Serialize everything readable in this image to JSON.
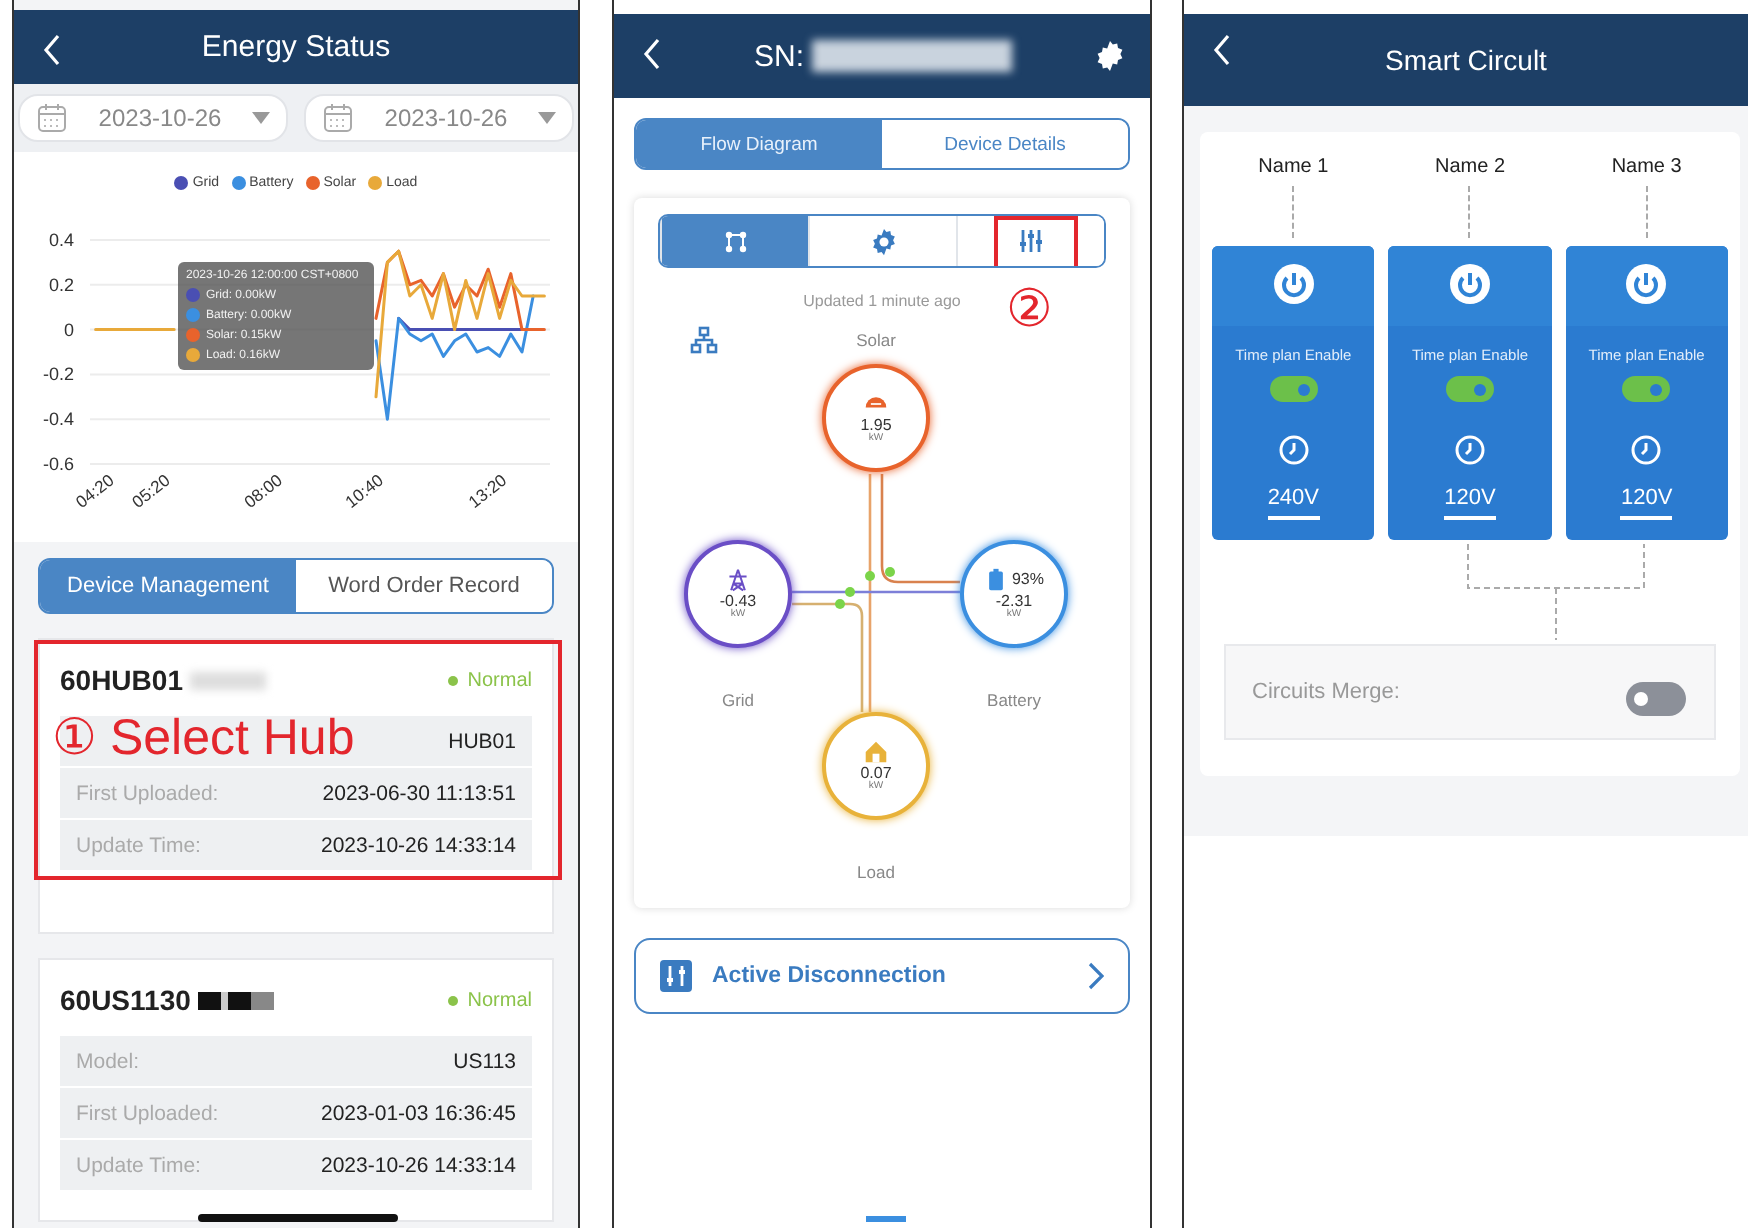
{
  "energy_status": {
    "title": "Energy Status",
    "date_from": "2023-10-26",
    "date_to": "2023-10-26",
    "chart_data": {
      "type": "line",
      "categories": [
        "04:20",
        null,
        null,
        null,
        null,
        "05:20",
        null,
        null,
        null,
        null,
        null,
        null,
        null,
        null,
        null,
        "08:00",
        null,
        null,
        null,
        null,
        null,
        null,
        null,
        null,
        "10:40",
        null,
        null,
        null,
        null,
        null,
        null,
        null,
        null,
        null,
        null,
        "13:20",
        null,
        null,
        null,
        null,
        null
      ],
      "grid": true,
      "legend": true,
      "ylim": [
        -0.6,
        0.4
      ],
      "yticks": [
        0.4,
        0.2,
        0,
        -0.2,
        -0.4,
        -0.6
      ],
      "series": [
        {
          "name": "Grid",
          "color": "#4a4fb3",
          "values": [
            null,
            null,
            null,
            null,
            null,
            null,
            null,
            null,
            null,
            null,
            null,
            null,
            null,
            null,
            null,
            null,
            null,
            null,
            null,
            null,
            null,
            null,
            null,
            null,
            null,
            null,
            null,
            0.05,
            0,
            0,
            0,
            0,
            0,
            0,
            0,
            0,
            0,
            0,
            0,
            null,
            null
          ]
        },
        {
          "name": "Battery",
          "color": "#3b8fe0",
          "values": [
            null,
            null,
            null,
            null,
            null,
            null,
            null,
            null,
            null,
            null,
            null,
            null,
            null,
            null,
            null,
            null,
            null,
            null,
            null,
            null,
            null,
            null,
            null,
            null,
            null,
            -0.05,
            -0.4,
            0.05,
            -0.02,
            -0.05,
            -0.02,
            -0.12,
            -0.05,
            -0.02,
            -0.1,
            -0.08,
            -0.12,
            -0.02,
            -0.1,
            0.15,
            null
          ]
        },
        {
          "name": "Solar",
          "color": "#e8632c",
          "values": [
            null,
            null,
            null,
            null,
            null,
            null,
            null,
            null,
            null,
            null,
            null,
            null,
            null,
            null,
            null,
            null,
            null,
            null,
            null,
            null,
            null,
            null,
            null,
            null,
            null,
            0.05,
            0.3,
            0.35,
            0.2,
            0.22,
            0.15,
            0.25,
            0.1,
            0.2,
            0.15,
            0.27,
            0.1,
            0.25,
            0,
            0,
            0
          ]
        },
        {
          "name": "Load",
          "color": "#e8a93a",
          "values": [
            0,
            0,
            0,
            0,
            0,
            0,
            0,
            0,
            null,
            null,
            null,
            null,
            null,
            null,
            null,
            null,
            null,
            null,
            null,
            null,
            null,
            null,
            null,
            null,
            null,
            -0.3,
            0.3,
            0.35,
            0.15,
            0.2,
            0.05,
            0.25,
            0,
            0.22,
            0.05,
            0.25,
            0.05,
            0.22,
            0.15,
            0.15,
            0.15
          ]
        }
      ]
    },
    "tooltip": {
      "title": "2023-10-26 12:00:00 CST+0800",
      "items": [
        "Grid: 0.00kW",
        "Battery: 0.00kW",
        "Solar: 0.15kW",
        "Load: 0.16kW"
      ]
    },
    "tabs": [
      {
        "label": "Device Management",
        "selected": true
      },
      {
        "label": "Word Order Record",
        "selected": false
      }
    ],
    "devices": [
      {
        "serial": "60HUB01",
        "status": "Normal",
        "rows": [
          {
            "value": "HUB01"
          },
          {
            "label": "First Uploaded:",
            "value": "2023-06-30 11:13:51"
          },
          {
            "label": "Update Time:",
            "value": "2023-10-26 14:33:14"
          }
        ]
      },
      {
        "serial": "60US1130",
        "status": "Normal",
        "rows": [
          {
            "label": "Model:",
            "value": "US113"
          },
          {
            "label": "First Uploaded:",
            "value": "2023-01-03 16:36:45"
          },
          {
            "label": "Update Time:",
            "value": "2023-10-26 14:33:14"
          }
        ]
      }
    ]
  },
  "device_screen": {
    "title": "SN:",
    "tabs": [
      {
        "label": "Flow Diagram",
        "selected": true
      },
      {
        "label": "Device Details",
        "selected": false
      }
    ],
    "view_tabs": [
      {
        "kind": "flow",
        "selected": true
      },
      {
        "kind": "settings",
        "selected": false
      },
      {
        "kind": "controls",
        "selected": false
      }
    ],
    "updated": "Updated 1 minute ago",
    "nodes": [
      {
        "kind": "solar",
        "label": "Solar",
        "value": "1.95",
        "unit": "kW"
      },
      {
        "kind": "grid",
        "label": "Grid",
        "value": "-0.43",
        "unit": "kW"
      },
      {
        "kind": "battery",
        "label": "Battery",
        "value": "-2.31",
        "unit": "kW",
        "percent": "93%"
      },
      {
        "kind": "load",
        "label": "Load",
        "value": "0.07",
        "unit": "kW"
      }
    ],
    "action": "Active Disconnection"
  },
  "smart_circuit": {
    "title": "Smart Circult",
    "circuits": [
      {
        "name": "Name 1",
        "plan_label": "Time plan Enable",
        "on": true,
        "voltage": "240V"
      },
      {
        "name": "Name 2",
        "plan_label": "Time plan Enable",
        "on": true,
        "voltage": "120V"
      },
      {
        "name": "Name 3",
        "plan_label": "Time plan Enable",
        "on": true,
        "voltage": "120V"
      }
    ],
    "merge": {
      "label": "Circuits Merge:",
      "on": false
    }
  },
  "annotations": [
    {
      "kind": "hub",
      "text": "① Select Hub"
    },
    {
      "kind": "tab",
      "text": "②"
    }
  ]
}
